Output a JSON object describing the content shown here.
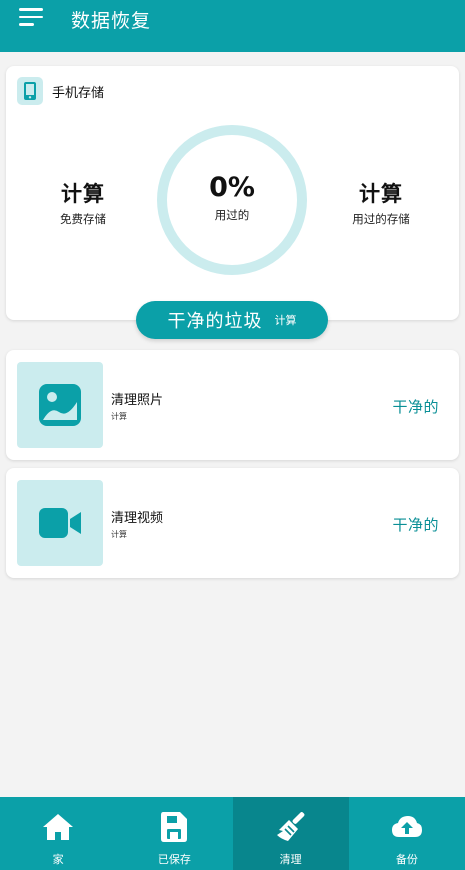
{
  "app": {
    "title": "数据恢复"
  },
  "storage": {
    "label": "手机存储",
    "free_value": "计算",
    "free_label": "免费存储",
    "used_percent_text": "0%",
    "used_percent": 0,
    "used_label": "用过的",
    "used_storage_value": "计算",
    "used_storage_label": "用过的存储"
  },
  "clean_junk": {
    "label": "干净的垃圾",
    "status": "计算"
  },
  "items": [
    {
      "title": "清理照片",
      "status": "计算",
      "action": "干净的",
      "icon": "image-icon"
    },
    {
      "title": "清理视频",
      "status": "计算",
      "action": "干净的",
      "icon": "video-icon"
    }
  ],
  "bottom_nav": [
    {
      "label": "家",
      "icon": "home-icon"
    },
    {
      "label": "已保存",
      "icon": "save-icon"
    },
    {
      "label": "清理",
      "icon": "broom-icon",
      "active": true
    },
    {
      "label": "备份",
      "icon": "cloud-upload-icon"
    }
  ],
  "colors": {
    "primary": "#0ba0a8",
    "primary_dark": "#08868d",
    "accent_light": "#cbecee",
    "action_text": "#0a8f96",
    "background": "#f3f3f3"
  }
}
